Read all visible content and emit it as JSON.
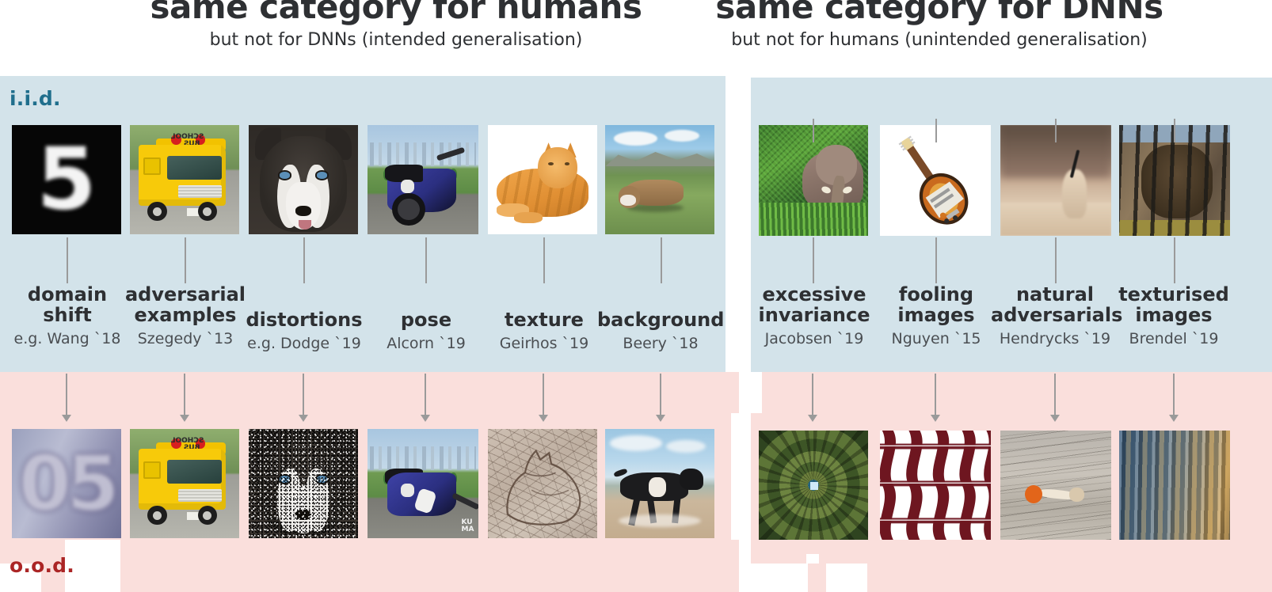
{
  "figure": {
    "left_heading": {
      "main": "same category for humans",
      "sub": "but not for DNNs (intended generalisation)"
    },
    "right_heading": {
      "main": "same category for DNNs",
      "sub": "but not for humans (unintended generalisation)"
    },
    "row_labels": {
      "iid": "i.i.d.",
      "ood": "o.o.d."
    },
    "colors": {
      "iid_panel": "#d3e3ea",
      "ood_panel": "#fadfdc",
      "iid_text": "#1f6e8c",
      "ood_text": "#ab2525",
      "heading_text": "#2e3033",
      "connector": "#9a9a9a",
      "page_background": "#ffffff"
    }
  },
  "left_panel": {
    "columns": [
      {
        "title": "domain\nshift",
        "title_line1": "domain",
        "title_line2": "shift",
        "cite": "e.g. Wang `18",
        "iid_image": "blurry-mnist-digit-5",
        "ood_image": "blurry-svhn-house-number-5"
      },
      {
        "title": "adversarial\nexamples",
        "title_line1": "adversarial",
        "title_line2": "examples",
        "cite": "Szegedy `13",
        "iid_image": "yellow-school-bus",
        "ood_image": "adversarially-perturbed-school-bus"
      },
      {
        "title": "distortions",
        "title_line1": "distortions",
        "title_line2": "",
        "cite": "e.g. Dodge `19",
        "iid_image": "husky-dog-face",
        "ood_image": "noise-corrupted-husky-dog-face"
      },
      {
        "title": "pose",
        "title_line1": "pose",
        "title_line2": "",
        "cite": "Alcorn `19",
        "iid_image": "blue-motorcycle-upright",
        "ood_image": "blue-motorcycle-crashed-upside-down"
      },
      {
        "title": "texture",
        "title_line1": "texture",
        "title_line2": "",
        "cite": "Geirhos `19",
        "iid_image": "orange-tabby-cat",
        "ood_image": "elephant-skin-texturised-cat-silhouette"
      },
      {
        "title": "background",
        "title_line1": "background",
        "title_line2": "",
        "cite": "Beery `18",
        "iid_image": "brown-cow-on-alpine-meadow",
        "ood_image": "black-and-white-cow-on-beach"
      }
    ]
  },
  "right_panel": {
    "columns": [
      {
        "title_line1": "excessive",
        "title_line2": "invariance",
        "cite": "Jacobsen `19",
        "iid_image": "elephant-in-green-jungle",
        "ood_image": "aerial-view-of-spiral-staircase"
      },
      {
        "title_line1": "fooling",
        "title_line2": "images",
        "cite": "Nguyen `15",
        "iid_image": "electric-guitar-on-white",
        "ood_image": "maroon-wave-pattern-fooling-image"
      },
      {
        "title_line1": "natural",
        "title_line2": "adversarials",
        "cite": "Hendrycks `19",
        "iid_image": "blurry-sepia-object-with-pin",
        "ood_image": "orange-tipped-pin-on-weathered-wood"
      },
      {
        "title_line1": "texturised",
        "title_line2": "images",
        "cite": "Brendel `19",
        "iid_image": "dog-behind-cage-bars",
        "ood_image": "texturised-painterly-shards"
      }
    ]
  }
}
